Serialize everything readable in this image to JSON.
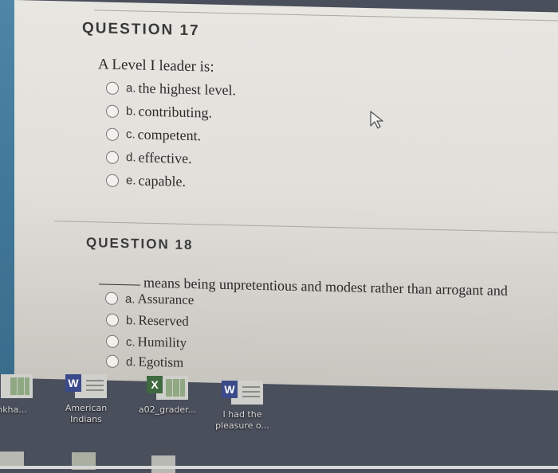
{
  "questions": [
    {
      "heading": "QUESTION 17",
      "prompt": "A Level I leader is:",
      "options": [
        {
          "letter": "a.",
          "text": "the highest level."
        },
        {
          "letter": "b.",
          "text": "contributing."
        },
        {
          "letter": "c.",
          "text": "competent."
        },
        {
          "letter": "d.",
          "text": "effective."
        },
        {
          "letter": "e.",
          "text": "capable."
        }
      ]
    },
    {
      "heading": "QUESTION 18",
      "prompt": "means being unpretentious and modest rather than arrogant and",
      "options": [
        {
          "letter": "a.",
          "text": "Assurance"
        },
        {
          "letter": "b.",
          "text": "Reserved"
        },
        {
          "letter": "c.",
          "text": "Humility"
        },
        {
          "letter": "d.",
          "text": "Egotism"
        }
      ]
    }
  ],
  "desktop": {
    "icons": [
      {
        "type": "excel",
        "label": "nkha..."
      },
      {
        "type": "word",
        "badge": "W",
        "label": "American Indians"
      },
      {
        "type": "excel",
        "badge": "X",
        "label": "a02_grader..."
      },
      {
        "type": "word",
        "badge": "W",
        "label": "I had the pleasure o..."
      }
    ]
  },
  "colors": {
    "word_badge": "#3b4a8a",
    "excel_badge": "#3f6a3f",
    "desktop_bg": "#4a4f5c"
  }
}
